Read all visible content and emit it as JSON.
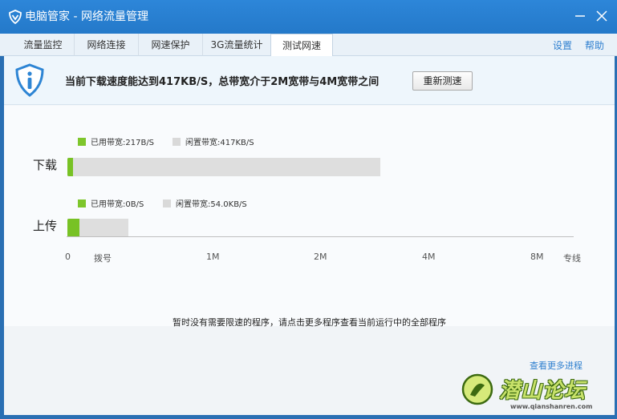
{
  "window": {
    "title": "电脑管家 - 网络流量管理",
    "icon": "shield-logo-icon",
    "minimize_icon": "minimize-icon",
    "close_icon": "close-icon"
  },
  "tabs": [
    {
      "label": "流量监控",
      "active": false
    },
    {
      "label": "网络连接",
      "active": false
    },
    {
      "label": "网速保护",
      "active": false
    },
    {
      "label": "3G流量统计",
      "active": false
    },
    {
      "label": "测试网速",
      "active": true
    }
  ],
  "top_links": {
    "settings": "设置",
    "help": "帮助"
  },
  "banner": {
    "icon": "info-shield-icon",
    "message": "当前下载速度能达到417KB/S，总带宽介于2M宽带与4M宽带之间",
    "retest_button": "重新测速"
  },
  "speed_chart": {
    "download": {
      "label": "下载",
      "used_text": "已用带宽:217B/S",
      "idle_text": "闲置带宽:417KB/S",
      "used_fraction": 0.01,
      "total_mbit": 3.1
    },
    "upload": {
      "label": "上传",
      "used_text": "已用带宽:0B/S",
      "idle_text": "闲置带宽:54.0KB/S",
      "used_fraction": 0.2,
      "total_mbit": 0.3
    },
    "axis_ticks": [
      "0",
      "拨号",
      "1M",
      "2M",
      "4M",
      "8M",
      "专线"
    ],
    "colors": {
      "used": "#78c225",
      "idle": "#dedede"
    }
  },
  "notice": "暂时没有需要限速的程序，请点击更多程序查看当前运行中的全部程序",
  "more_link": "查看更多进程",
  "watermark": {
    "text": "潜山论坛",
    "url": "www.qianshanren.com"
  }
}
